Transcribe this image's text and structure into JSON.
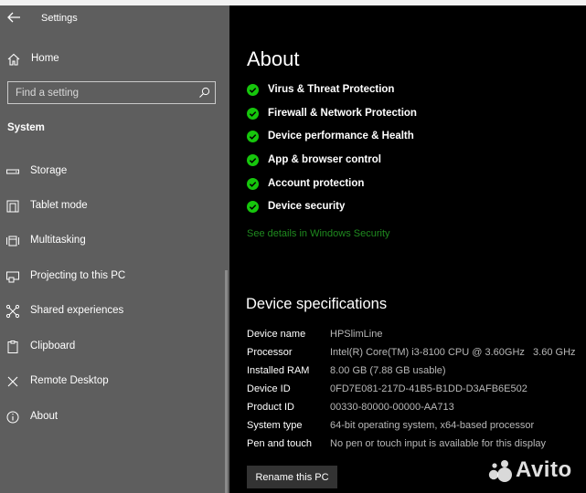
{
  "window": {
    "title": "Settings"
  },
  "sidebar": {
    "home_label": "Home",
    "search_placeholder": "Find a setting",
    "section_title": "System",
    "items": [
      {
        "label": "Storage",
        "icon": "storage-icon"
      },
      {
        "label": "Tablet mode",
        "icon": "tablet-mode-icon"
      },
      {
        "label": "Multitasking",
        "icon": "multitasking-icon"
      },
      {
        "label": "Projecting to this PC",
        "icon": "projecting-icon"
      },
      {
        "label": "Shared experiences",
        "icon": "shared-experiences-icon"
      },
      {
        "label": "Clipboard",
        "icon": "clipboard-icon"
      },
      {
        "label": "Remote Desktop",
        "icon": "remote-desktop-icon"
      },
      {
        "label": "About",
        "icon": "info-icon"
      }
    ]
  },
  "main": {
    "title": "About",
    "security_items": [
      "Virus & Threat Protection",
      "Firewall & Network Protection",
      "Device performance & Health",
      "App & browser control",
      "Account protection",
      "Device security"
    ],
    "see_details": "See details in Windows Security",
    "specs_title": "Device specifications",
    "specs": [
      {
        "key": "Device name",
        "value": "HPSlimLine"
      },
      {
        "key": "Processor",
        "value": "Intel(R) Core(TM) i3-8100 CPU @ 3.60GHz   3.60 GHz"
      },
      {
        "key": "Installed RAM",
        "value": "8.00 GB (7.88 GB usable)"
      },
      {
        "key": "Device ID",
        "value": "0FD7E081-217D-41B5-B1DD-D3AFB6E502"
      },
      {
        "key": "Product ID",
        "value": "00330-80000-00000-AA713"
      },
      {
        "key": "System type",
        "value": "64-bit operating system, x64-based processor"
      },
      {
        "key": "Pen and touch",
        "value": "No pen or touch input is available for this display"
      }
    ],
    "rename_label": "Rename this PC"
  },
  "colors": {
    "sidebar_bg": "#5e5e5e",
    "main_bg": "#000000",
    "check_green": "#16c60c",
    "link_green": "#1f8a1f",
    "button_bg": "#333333"
  },
  "watermark": {
    "text": "Avito"
  }
}
